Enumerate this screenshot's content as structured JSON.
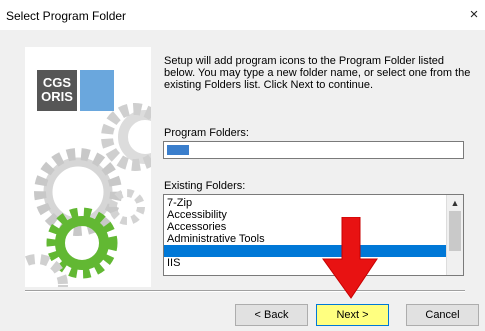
{
  "window": {
    "title": "Select Program Folder",
    "close_glyph": "×"
  },
  "logo": {
    "line1": "CGS",
    "line2": "ORIS"
  },
  "description": "Setup will add program icons to the Program Folder listed below. You may type a new folder name, or select one from the existing Folders list.  Click Next to continue.",
  "program_folders": {
    "label": "Program Folders:",
    "value": ""
  },
  "existing_folders": {
    "label": "Existing Folders:",
    "items": [
      "7-Zip",
      "Accessibility",
      "Accessories",
      "Administrative Tools",
      "",
      "IIS"
    ],
    "selected_index": 4
  },
  "buttons": {
    "back": "< Back",
    "next": "Next >",
    "cancel": "Cancel"
  },
  "colors": {
    "selection": "#0078d7",
    "next_highlight": "#ffff80",
    "arrow": "#e81212",
    "gear_green": "#62b833",
    "logo_blue": "#6aa7dd"
  }
}
